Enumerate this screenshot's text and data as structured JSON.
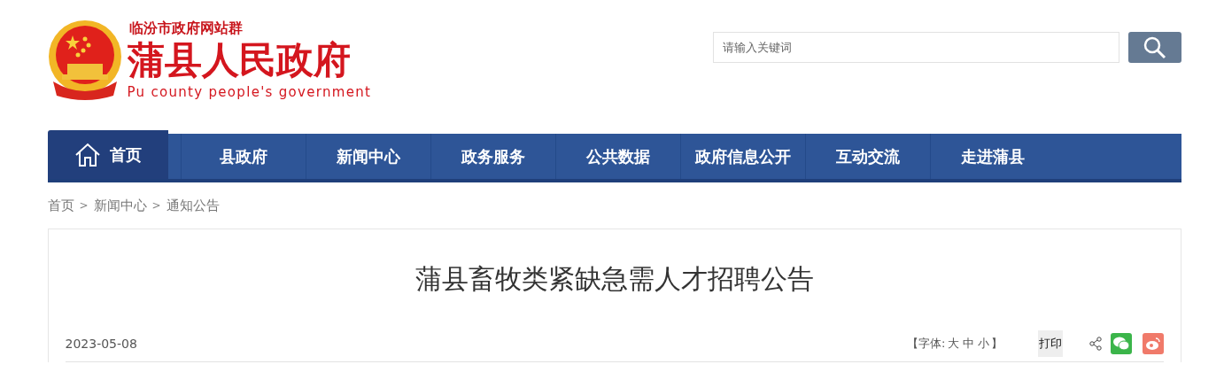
{
  "header": {
    "site_group": "临汾市政府网站群",
    "title": "蒲县人民政府",
    "subtitle": "Pu county people's government"
  },
  "search": {
    "placeholder": "请输入关键词"
  },
  "nav": [
    {
      "label": "首页",
      "selected": true
    },
    {
      "label": "县政府",
      "selected": false
    },
    {
      "label": "新闻中心",
      "selected": false
    },
    {
      "label": "政务服务",
      "selected": false
    },
    {
      "label": "公共数据",
      "selected": false
    },
    {
      "label": "政府信息公开",
      "selected": false
    },
    {
      "label": "互动交流",
      "selected": false
    },
    {
      "label": "走进蒲县",
      "selected": false
    }
  ],
  "breadcrumb": [
    "首页",
    "新闻中心",
    "通知公告"
  ],
  "breadcrumb_separator": ">",
  "article": {
    "title": "蒲县畜牧类紧缺急需人才招聘公告",
    "date": "2023-05-08",
    "font_size": {
      "open": "【字体:",
      "options": [
        "大",
        "中",
        "小"
      ],
      "close": "】"
    },
    "print": "打印"
  }
}
